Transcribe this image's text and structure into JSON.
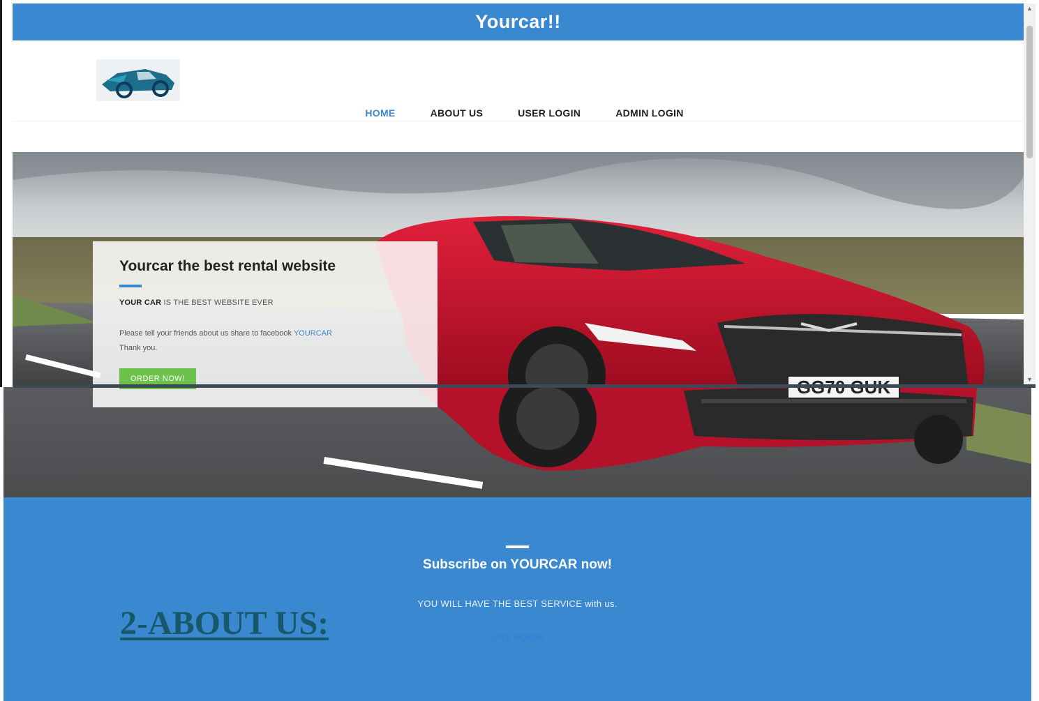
{
  "site": {
    "title": "Yourcar!!"
  },
  "nav": {
    "items": [
      {
        "label": "HOME",
        "active": true
      },
      {
        "label": "ABOUT US",
        "active": false
      },
      {
        "label": "USER LOGIN",
        "active": false
      },
      {
        "label": "ADMIN LOGIN",
        "active": false
      }
    ]
  },
  "hero": {
    "plate": "GG70 GUK"
  },
  "card": {
    "title": "Yourcar the best rental website",
    "brand": "YOUR CAR",
    "line1_rest": " IS THE BEST WEBSITE EVER",
    "line2": "Please tell your friends about us share to facebook ",
    "link": "YOURCAR",
    "thanks": "Thank you.",
    "button": "ORDER NOW!"
  },
  "subscribe": {
    "title": "Subscribe on YOURCAR now!",
    "text": "YOU WILL HAVE THE BEST SERVICE with us.",
    "link": "Click register"
  },
  "document": {
    "heading": "2-ABOUT US:"
  },
  "colors": {
    "primary": "#3a89d0",
    "button_green": "#6cc24a",
    "car_red": "#c8102e",
    "heading_teal": "#17586b"
  }
}
